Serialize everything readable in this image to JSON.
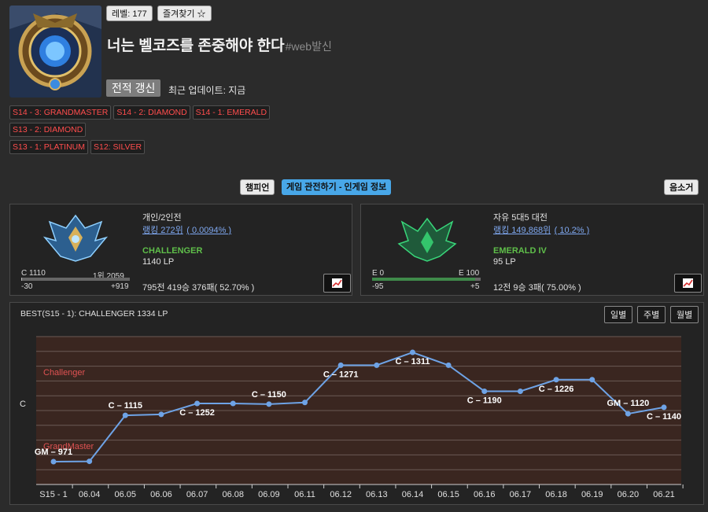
{
  "profile": {
    "level_label": "레벨: 177",
    "favorite_label": "즐겨찾기 ☆",
    "name": "너는 벨코즈를 존중해야 한다",
    "tag": "#web발신",
    "refresh_label": "전적 갱신",
    "updated_text": "최근 업데이트: 지금"
  },
  "season_badges": [
    "S14 - 3: GRANDMASTER",
    "S14 - 2: DIAMOND",
    "S14 - 1: EMERALD",
    "S13 - 2: DIAMOND",
    "S13 - 1: PLATINUM",
    "S12: SILVER"
  ],
  "nav": {
    "champion_label": "챔피언",
    "ingame_label": "게임 관전하기 - 인게임 정보",
    "mute_label": "음소거"
  },
  "solo": {
    "queue": "개인/2인전",
    "ranking": "랭킹 272위",
    "percent": "( 0.0094% )",
    "tier": "CHALLENGER",
    "lp": "1140 LP",
    "bar_left": "C 1110",
    "bar_right": "1위 2059",
    "bar_fill": 0.01,
    "delta_left": "-30",
    "delta_right": "+919",
    "record": "795전 419승 376패( 52.70% )"
  },
  "flex": {
    "queue": "자유 5대5 대전",
    "ranking": "랭킹 149,868위",
    "percent": "( 10.2% )",
    "tier": "EMERALD IV",
    "lp": "95 LP",
    "bar_left": "E 0",
    "bar_right": "E 100",
    "bar_fill": 0.95,
    "delta_left": "-95",
    "delta_right": "+5",
    "record": "12전 9승 3패( 75.00% )"
  },
  "graph": {
    "best_label": "BEST(S15 - 1): CHALLENGER 1334 LP",
    "periods": [
      "일별",
      "주별",
      "월별"
    ],
    "y_label": "C",
    "bands": [
      "Challenger",
      "GrandMaster"
    ]
  },
  "chart_data": {
    "type": "line",
    "x": [
      "S15 - 1",
      "06.04",
      "06.05",
      "06.06",
      "06.07",
      "06.08",
      "06.09",
      "06.11",
      "06.12",
      "06.13",
      "06.14",
      "06.15",
      "06.16",
      "06.17",
      "06.18",
      "06.19",
      "06.20",
      "06.21"
    ],
    "series": [
      {
        "values": [
          971,
          972,
          1115,
          1118,
          1152,
          1152,
          1150,
          1155,
          1271,
          1271,
          1311,
          1271,
          1190,
          1190,
          1226,
          1226,
          1120,
          1140
        ]
      }
    ],
    "point_labels": [
      {
        "x": "S15 - 1",
        "text": "GM – 971"
      },
      {
        "x": "06.05",
        "text": "C – 1115"
      },
      {
        "x": "06.07",
        "text": "C – 1252"
      },
      {
        "x": "06.09",
        "text": "C – 1150"
      },
      {
        "x": "06.12",
        "text": "C – 1271"
      },
      {
        "x": "06.14",
        "text": "C – 1311"
      },
      {
        "x": "06.16",
        "text": "C – 1190"
      },
      {
        "x": "06.18",
        "text": "C – 1226"
      },
      {
        "x": "06.20",
        "text": "GM – 1120"
      },
      {
        "x": "06.21",
        "text": "C – 1140"
      }
    ],
    "line_color": "#6ea3e6",
    "background_color": "#3a2620"
  }
}
